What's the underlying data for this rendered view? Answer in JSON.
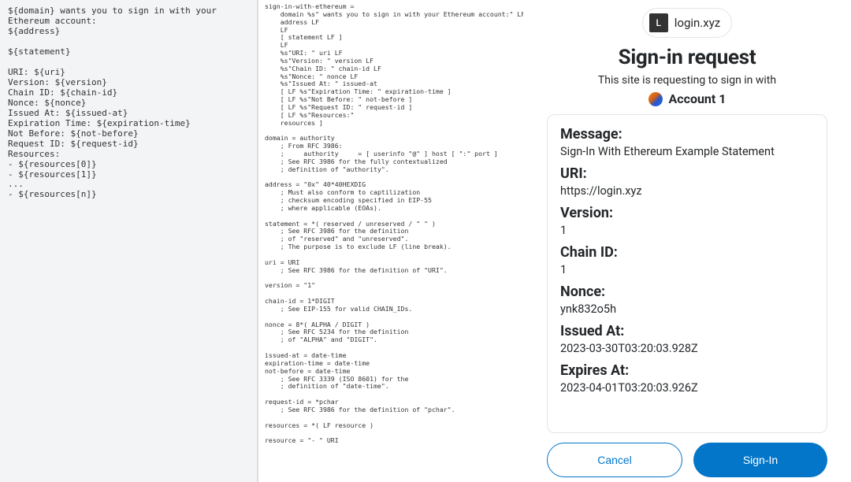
{
  "template": {
    "text": "${domain} wants you to sign in with your Ethereum account:\n${address}\n\n${statement}\n\nURI: ${uri}\nVersion: ${version}\nChain ID: ${chain-id}\nNonce: ${nonce}\nIssued At: ${issued-at}\nExpiration Time: ${expiration-time}\nNot Before: ${not-before}\nRequest ID: ${request-id}\nResources:\n- ${resources[0]}\n- ${resources[1]}\n...\n- ${resources[n]}"
  },
  "abnf": {
    "text": "sign-in-with-ethereum =\n    domain %s\" wants you to sign in with your Ethereum account:\" LF\n    address LF\n    LF\n    [ statement LF ]\n    LF\n    %s\"URI: \" uri LF\n    %s\"Version: \" version LF\n    %s\"Chain ID: \" chain-id LF\n    %s\"Nonce: \" nonce LF\n    %s\"Issued At: \" issued-at\n    [ LF %s\"Expiration Time: \" expiration-time ]\n    [ LF %s\"Not Before: \" not-before ]\n    [ LF %s\"Request ID: \" request-id ]\n    [ LF %s\"Resources:\"\n    resources ]\n\ndomain = authority\n    ; From RFC 3986:\n    ;     authority     = [ userinfo \"@\" ] host [ \":\" port ]\n    ; See RFC 3986 for the fully contextualized\n    ; definition of \"authority\".\n\naddress = \"0x\" 40*40HEXDIG\n    ; Must also conform to captilization\n    ; checksum encoding specified in EIP-55\n    ; where applicable (EOAs).\n\nstatement = *( reserved / unreserved / \" \" )\n    ; See RFC 3986 for the definition\n    ; of \"reserved\" and \"unreserved\".\n    ; The purpose is to exclude LF (line break).\n\nuri = URI\n    ; See RFC 3986 for the definition of \"URI\".\n\nversion = \"1\"\n\nchain-id = 1*DIGIT\n    ; See EIP-155 for valid CHAIN_IDs.\n\nnonce = 8*( ALPHA / DIGIT )\n    ; See RFC 5234 for the definition\n    ; of \"ALPHA\" and \"DIGIT\".\n\nissued-at = date-time\nexpiration-time = date-time\nnot-before = date-time\n    ; See RFC 3339 (ISO 8601) for the\n    ; definition of \"date-time\".\n\nrequest-id = *pchar\n    ; See RFC 3986 for the definition of \"pchar\".\n\nresources = *( LF resource )\n\nresource = \"- \" URI"
  },
  "popup": {
    "origin": "login.xyz",
    "site_icon_text": "L",
    "title": "Sign-in request",
    "subtitle": "This site is requesting to sign in with",
    "account_name": "Account 1",
    "fields": {
      "message_label": "Message:",
      "message_value": "Sign-In With Ethereum Example Statement",
      "uri_label": "URI:",
      "uri_value": "https://login.xyz",
      "version_label": "Version:",
      "version_value": "1",
      "chainid_label": "Chain ID:",
      "chainid_value": "1",
      "nonce_label": "Nonce:",
      "nonce_value": "ynk832o5h",
      "issued_label": "Issued At:",
      "issued_value": "2023-03-30T03:20:03.928Z",
      "expires_label": "Expires At:",
      "expires_value": "2023-04-01T03:20:03.926Z"
    },
    "buttons": {
      "cancel": "Cancel",
      "signin": "Sign-In"
    }
  }
}
